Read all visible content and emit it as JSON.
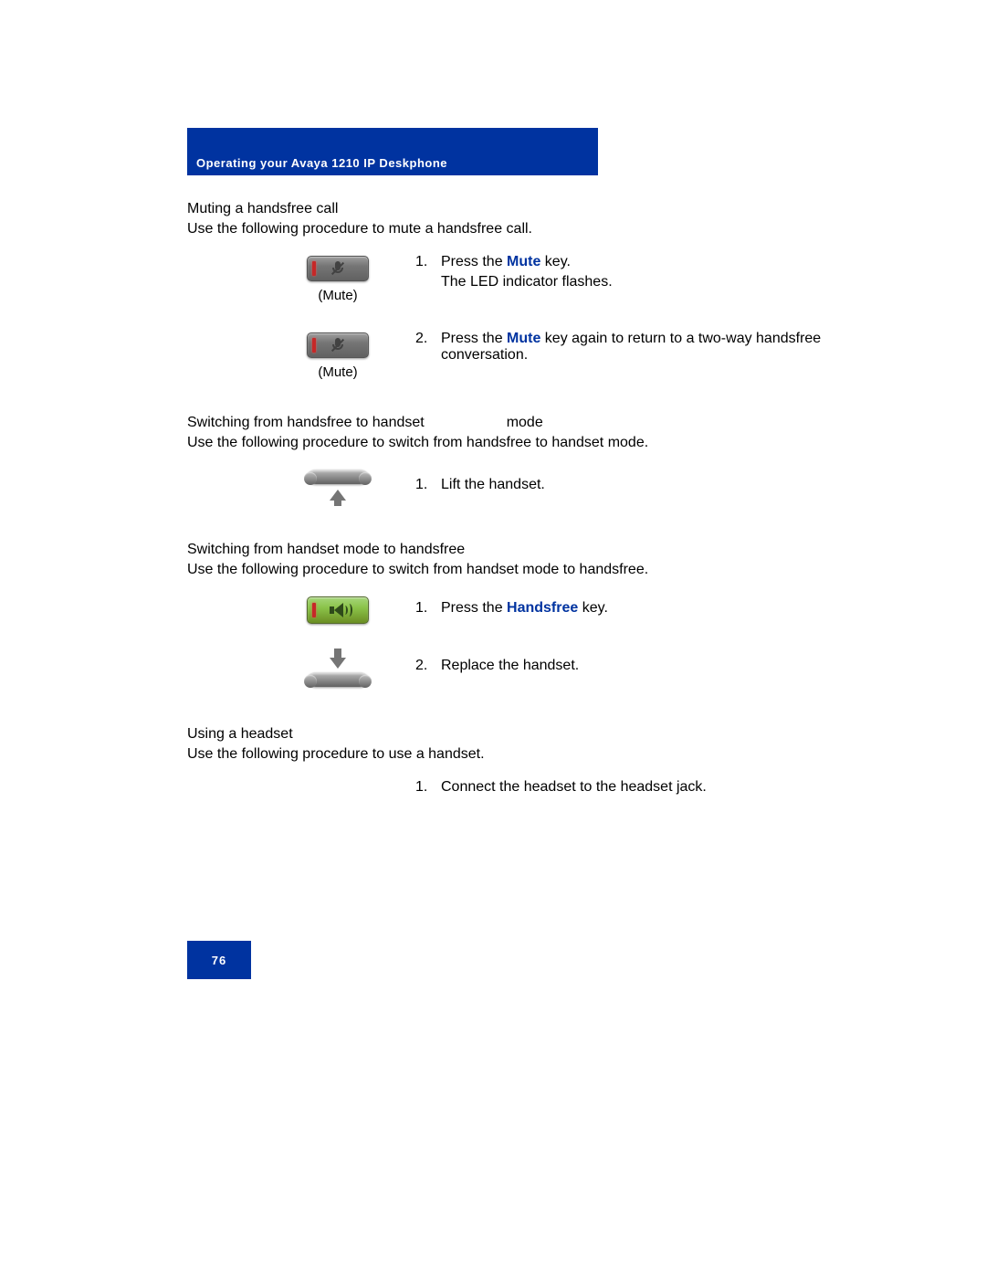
{
  "header": {
    "title": "Operating your Avaya 1210 IP Deskphone"
  },
  "sections": {
    "muting": {
      "title": "Muting a handsfree call",
      "desc": "Use the following procedure to mute a handsfree call.",
      "step1_num": "1.",
      "step1_pre": "Press the ",
      "step1_key": "Mute",
      "step1_post": " key.",
      "step1_line2": "The LED indicator flashes.",
      "icon1_caption": "(Mute)",
      "step2_num": "2.",
      "step2_pre": "Press the ",
      "step2_key": "Mute",
      "step2_post": " key again to return to a two-way handsfree conversation.",
      "icon2_caption": "(Mute)"
    },
    "hf_to_hs": {
      "title_a": "Switching from handsfree to handset",
      "title_b": "mode",
      "desc": "Use the following procedure to switch from handsfree to handset mode.",
      "step1_num": "1.",
      "step1_text": "Lift the handset."
    },
    "hs_to_hf": {
      "title": "Switching from handset mode to handsfree",
      "desc": "Use the following procedure to switch from handset mode to handsfree.",
      "step1_num": "1.",
      "step1_pre": "Press the ",
      "step1_key": "Handsfree",
      "step1_post": " key.",
      "step2_num": "2.",
      "step2_text": "Replace the handset."
    },
    "headset": {
      "title": "Using a headset",
      "desc": "Use the following procedure to use a handset.",
      "step1_num": "1.",
      "step1_text": "Connect the headset to the headset jack."
    }
  },
  "footer": {
    "page_number": "76"
  }
}
